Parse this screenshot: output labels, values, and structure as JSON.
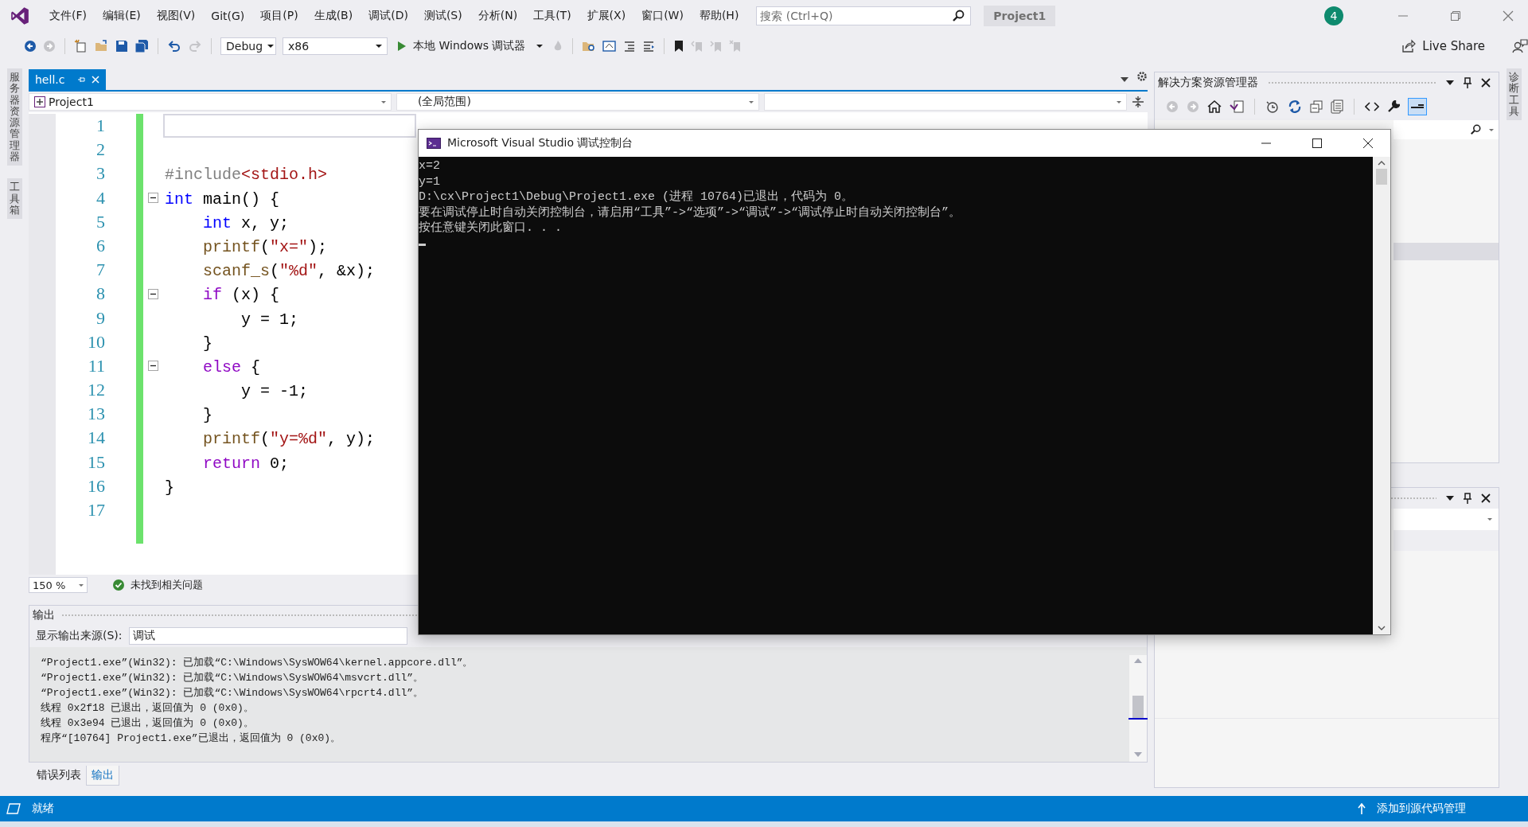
{
  "menu": [
    "文件(F)",
    "编辑(E)",
    "视图(V)",
    "Git(G)",
    "项目(P)",
    "生成(B)",
    "调试(D)",
    "测试(S)",
    "分析(N)",
    "工具(T)",
    "扩展(X)",
    "窗口(W)",
    "帮助(H)"
  ],
  "search": {
    "placeholder": "搜索 (Ctrl+Q)"
  },
  "project_badge": "Project1",
  "notification_count": "4",
  "toolbar": {
    "configuration": "Debug",
    "platform": "x86",
    "run_label": "本地 Windows 调试器",
    "live_share": "Live Share"
  },
  "left_tool_tabs": [
    "服务器资源管理器",
    "工具箱"
  ],
  "right_tool_tabs": [
    "诊断工具"
  ],
  "document_tabs": [
    {
      "label": "hell.c",
      "selected": true
    }
  ],
  "navigation_bar": {
    "project": "Project1",
    "scope": "(全局范围)"
  },
  "editor": {
    "lines": [
      {
        "number": "1",
        "current": true,
        "fold": false
      },
      {
        "number": "2",
        "current": false,
        "fold": false
      },
      {
        "number": "3",
        "current": false,
        "fold": false,
        "tokens": [
          {
            "kind": "preprocessor",
            "text": "#include"
          },
          {
            "kind": "string",
            "text": "<stdio.h>"
          }
        ]
      },
      {
        "number": "4",
        "current": false,
        "fold": true,
        "tokens": [
          {
            "kind": "keyword",
            "text": "int"
          },
          {
            "kind": "plain",
            "text": " main() {"
          }
        ]
      },
      {
        "number": "5",
        "current": false,
        "fold": false,
        "tokens": [
          {
            "kind": "keyword",
            "text": "    int"
          },
          {
            "kind": "plain",
            "text": " x, y;"
          }
        ]
      },
      {
        "number": "6",
        "current": false,
        "fold": false,
        "tokens": [
          {
            "kind": "function",
            "text": "    printf"
          },
          {
            "kind": "plain",
            "text": "("
          },
          {
            "kind": "string",
            "text": "\"x=\""
          },
          {
            "kind": "plain",
            "text": ");"
          }
        ]
      },
      {
        "number": "7",
        "current": false,
        "fold": false,
        "tokens": [
          {
            "kind": "function",
            "text": "    scanf_s"
          },
          {
            "kind": "plain",
            "text": "("
          },
          {
            "kind": "string",
            "text": "\"%d\""
          },
          {
            "kind": "plain",
            "text": ", &x);"
          }
        ]
      },
      {
        "number": "8",
        "current": false,
        "fold": true,
        "tokens": [
          {
            "kind": "control",
            "text": "    if"
          },
          {
            "kind": "plain",
            "text": " (x) {"
          }
        ]
      },
      {
        "number": "9",
        "current": false,
        "fold": false,
        "tokens": [
          {
            "kind": "plain",
            "text": "        y = 1;"
          }
        ]
      },
      {
        "number": "10",
        "current": false,
        "fold": false,
        "tokens": [
          {
            "kind": "plain",
            "text": "    }"
          }
        ]
      },
      {
        "number": "11",
        "current": false,
        "fold": true,
        "tokens": [
          {
            "kind": "control",
            "text": "    else"
          },
          {
            "kind": "plain",
            "text": " {"
          }
        ]
      },
      {
        "number": "12",
        "current": false,
        "fold": false,
        "tokens": [
          {
            "kind": "plain",
            "text": "        y = -1;"
          }
        ]
      },
      {
        "number": "13",
        "current": false,
        "fold": false,
        "tokens": [
          {
            "kind": "plain",
            "text": "    }"
          }
        ]
      },
      {
        "number": "14",
        "current": false,
        "fold": false,
        "tokens": [
          {
            "kind": "function",
            "text": "    printf"
          },
          {
            "kind": "plain",
            "text": "("
          },
          {
            "kind": "string",
            "text": "\"y=%d\""
          },
          {
            "kind": "plain",
            "text": ", y);"
          }
        ]
      },
      {
        "number": "15",
        "current": false,
        "fold": false,
        "tokens": [
          {
            "kind": "control",
            "text": "    return"
          },
          {
            "kind": "plain",
            "text": " 0;"
          }
        ]
      },
      {
        "number": "16",
        "current": false,
        "fold": false,
        "tokens": [
          {
            "kind": "plain",
            "text": "}"
          }
        ]
      },
      {
        "number": "17",
        "current": false,
        "fold": false
      }
    ]
  },
  "zoom": "150 %",
  "issues": "未找到相关问题",
  "output": {
    "title": "输出",
    "source_label": "显示输出来源(S):",
    "source": "调试",
    "lines": [
      "“Project1.exe”(Win32): 已加载“C:\\Windows\\SysWOW64\\kernel.appcore.dll”。",
      "“Project1.exe”(Win32): 已加载“C:\\Windows\\SysWOW64\\msvcrt.dll”。",
      "“Project1.exe”(Win32): 已加载“C:\\Windows\\SysWOW64\\rpcrt4.dll”。",
      "线程 0x2f18 已退出，返回值为 0 (0x0)。",
      "线程 0x3e94 已退出，返回值为 0 (0x0)。",
      "程序“[10764] Project1.exe”已退出，返回值为 0 (0x0)。"
    ]
  },
  "bottom_tabs": [
    {
      "label": "错误列表",
      "selected": false
    },
    {
      "label": "输出",
      "selected": true
    }
  ],
  "solution_explorer": {
    "title": "解决方案资源管理器"
  },
  "status_bar": {
    "text": "就绪",
    "source_control": "添加到源代码管理"
  },
  "console": {
    "title": "Microsoft Visual Studio 调试控制台",
    "lines": [
      "x=2",
      "y=1",
      "D:\\cx\\Project1\\Debug\\Project1.exe (进程 10764)已退出，代码为 0。",
      "要在调试停止时自动关闭控制台，请启用“工具”->“选项”->“调试”->“调试停止时自动关闭控制台”。",
      "按任意键关闭此窗口. . ."
    ]
  }
}
